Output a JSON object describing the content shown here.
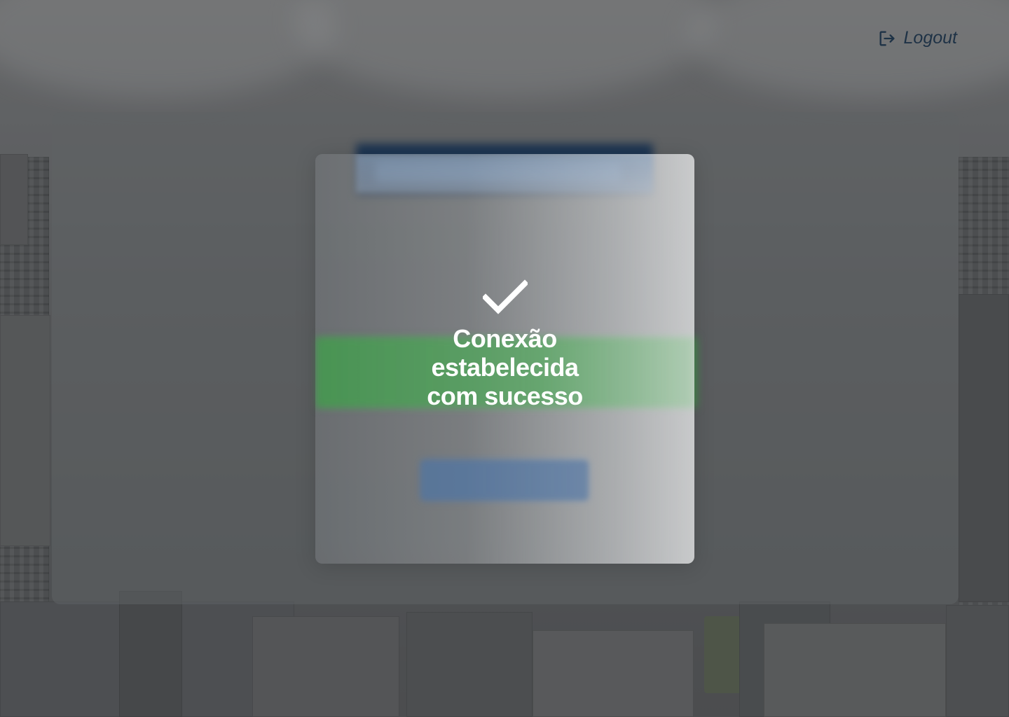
{
  "header": {
    "logout_label": "Logout",
    "logout_icon": "logout-icon"
  },
  "modal": {
    "icon": "check-icon",
    "message": "Conexão\nestabelecida\ncom sucesso",
    "icon_color": "#ffffff"
  },
  "colors": {
    "logout_text": "#1e3246",
    "success_green": "#3f8f48",
    "navy": "#1d3552",
    "button_blue": "#3a5d86"
  }
}
